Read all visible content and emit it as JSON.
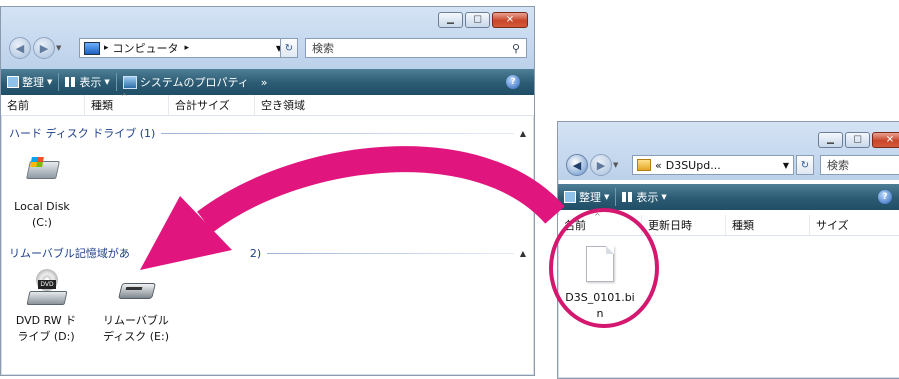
{
  "left_window": {
    "address": {
      "path": "コンピュータ",
      "arrow": "▸"
    },
    "search_placeholder": "検索",
    "toolbar": {
      "organize": "整理",
      "views": "表示",
      "system_properties": "システムのプロパティ",
      "more": "»"
    },
    "columns": [
      "名前",
      "種類",
      "合計サイズ",
      "空き領域"
    ],
    "groups": [
      {
        "label": "ハード ディスク ドライブ (1)"
      },
      {
        "label": "リムーバブル記憶域があるデバイス (2)",
        "visible": "リムーバブル記憶域があ",
        "tail": "2)"
      }
    ],
    "items": [
      {
        "line1": "Local Disk",
        "line2": "(C:)",
        "icon": "hard-disk-icon"
      },
      {
        "line1": "DVD RW ド",
        "line2": "ライブ (D:)",
        "icon": "dvd-drive-icon",
        "badge": "DVD"
      },
      {
        "line1": "リムーバブル",
        "line2": "ディスク (E:)",
        "icon": "removable-disk-icon"
      }
    ]
  },
  "right_window": {
    "address": {
      "prefix": "«",
      "path": "D3SUpd..."
    },
    "search_placeholder": "検索",
    "toolbar": {
      "organize": "整理",
      "views": "表示"
    },
    "columns": [
      "名前",
      "更新日時",
      "種類",
      "サイズ"
    ],
    "file": {
      "line1": "D3S_0101.bi",
      "line2": "n",
      "icon": "file-icon"
    }
  },
  "colors": {
    "arrow": "#e0157d",
    "circle": "#d4176f",
    "toolbar": "#2b5b73",
    "group_text": "#1e3f8a"
  }
}
